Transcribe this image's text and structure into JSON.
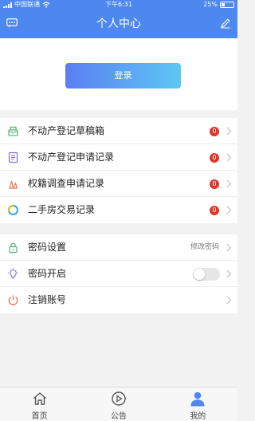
{
  "status_bar": {
    "carrier": "中国联通",
    "time": "下午6:31",
    "battery": "25%",
    "battery_level": 0.25
  },
  "header": {
    "title": "个人中心",
    "left_icon": "message-icon",
    "right_icon": "edit-icon"
  },
  "login": {
    "label": "登录",
    "gradient_from": "#5a7ef3",
    "gradient_to": "#5ec6f3"
  },
  "menu_primary": [
    {
      "label": "不动产登记草稿箱",
      "badge": "0",
      "icon": "draft-box-icon"
    },
    {
      "label": "不动产登记申请记录",
      "badge": "0",
      "icon": "document-icon"
    },
    {
      "label": "权籍调查申请记录",
      "badge": "0",
      "icon": "survey-icon"
    },
    {
      "label": "二手房交易记录",
      "badge": "0",
      "icon": "pie-chart-icon"
    }
  ],
  "menu_secondary": [
    {
      "label": "密码设置",
      "value": "修改密码",
      "icon": "lock-icon"
    },
    {
      "label": "密码开启",
      "toggle": false,
      "icon": "lightbulb-icon"
    },
    {
      "label": "注销账号",
      "icon": "power-icon"
    }
  ],
  "tabbar": [
    {
      "label": "首页",
      "icon": "home-icon"
    },
    {
      "label": "公告",
      "icon": "play-circle-icon"
    },
    {
      "label": "我的",
      "icon": "user-icon",
      "active": true
    }
  ],
  "colors": {
    "brand": "#4d87f0",
    "badge": "#e0352b",
    "active_tab": "#4d87f0"
  }
}
